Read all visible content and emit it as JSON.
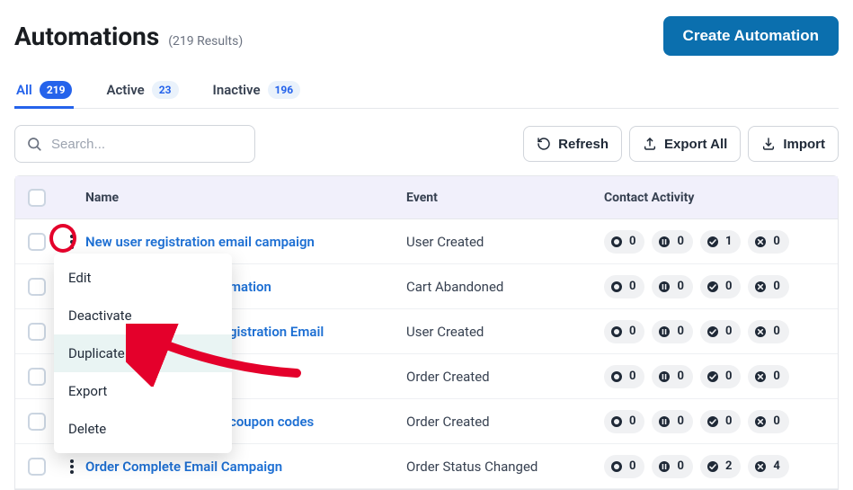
{
  "header": {
    "title": "Automations",
    "result_count": "(219 Results)",
    "create_label": "Create Automation"
  },
  "tabs": {
    "all": {
      "label": "All",
      "count": "219"
    },
    "active": {
      "label": "Active",
      "count": "23"
    },
    "inactive": {
      "label": "Inactive",
      "count": "196"
    }
  },
  "toolbar": {
    "search_placeholder": "Search...",
    "refresh": "Refresh",
    "export_all": "Export All",
    "import": "Import"
  },
  "columns": {
    "name": "Name",
    "event": "Event",
    "activity": "Contact Activity"
  },
  "rows": [
    {
      "name": "New user registration email campaign",
      "event": "User Created",
      "stats": {
        "o": "0",
        "pause": "0",
        "check": "1",
        "x": "0"
      }
    },
    {
      "name": "mation",
      "event": "Cart Abandoned",
      "stats": {
        "o": "0",
        "pause": "0",
        "check": "0",
        "x": "0"
      }
    },
    {
      "name": "gistration Email",
      "event": "User Created",
      "stats": {
        "o": "0",
        "pause": "0",
        "check": "0",
        "x": "0"
      }
    },
    {
      "name": "",
      "event": "Order Created",
      "stats": {
        "o": "0",
        "pause": "0",
        "check": "0",
        "x": "0"
      }
    },
    {
      "name": "coupon codes",
      "event": "Order Created",
      "stats": {
        "o": "0",
        "pause": "0",
        "check": "0",
        "x": "0"
      }
    },
    {
      "name": "Order Complete Email Campaign",
      "event": "Order Status Changed",
      "stats": {
        "o": "0",
        "pause": "0",
        "check": "2",
        "x": "4"
      }
    }
  ],
  "menu": {
    "edit": "Edit",
    "deactivate": "Deactivate",
    "duplicate": "Duplicate",
    "export": "Export",
    "delete": "Delete"
  }
}
